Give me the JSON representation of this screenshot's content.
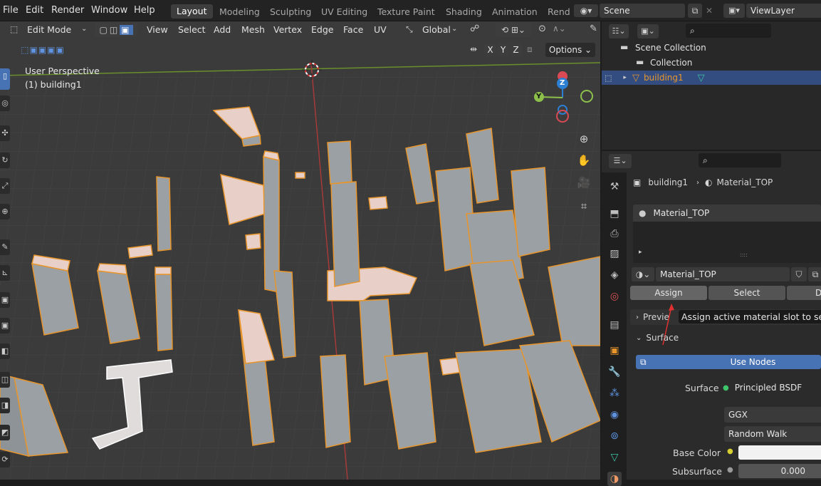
{
  "menubar": {
    "items": [
      "File",
      "Edit",
      "Render",
      "Window",
      "Help"
    ]
  },
  "workspaces": [
    "Layout",
    "Modeling",
    "Sculpting",
    "UV Editing",
    "Texture Paint",
    "Shading",
    "Animation",
    "Rend"
  ],
  "scene": {
    "name": "Scene",
    "view_layer": "ViewLayer"
  },
  "viewport": {
    "mode": "Edit Mode",
    "menus": [
      "View",
      "Select",
      "Add",
      "Mesh",
      "Vertex",
      "Edge",
      "Face",
      "UV"
    ],
    "orientation": "Global",
    "axes": [
      "X",
      "Y",
      "Z"
    ],
    "options_label": "Options",
    "perspective": "User Perspective",
    "object_label": "(1) building1",
    "gizmo": {
      "x": "X",
      "y": "Y",
      "z": "Z"
    }
  },
  "outliner": {
    "search_placeholder": "",
    "scene_collection": "Scene Collection",
    "collection": "Collection",
    "object": "building1"
  },
  "properties": {
    "breadcrumb_object": "building1",
    "breadcrumb_material": "Material_TOP",
    "slot_name": "Material_TOP",
    "slot_handle": "::::",
    "material_name": "Material_TOP",
    "assign_label": "Assign",
    "select_label": "Select",
    "deselect_label": "Des",
    "preview_label": "Previe",
    "tooltip": "Assign active material slot to selec",
    "surface_panel": "Surface",
    "use_nodes_label": "Use Nodes",
    "surface_label": "Surface",
    "surface_value": "Principled BSDF",
    "distribution": "GGX",
    "subsurface_method": "Random Walk",
    "base_color_label": "Base Color",
    "subsurface_label": "Subsurface",
    "subsurface_value": "0.000"
  },
  "colors": {
    "accent": "#4772b3",
    "selected_row": "#334d80",
    "edge_orange": "#e8952c",
    "face_pink": "#e8d0c8"
  }
}
